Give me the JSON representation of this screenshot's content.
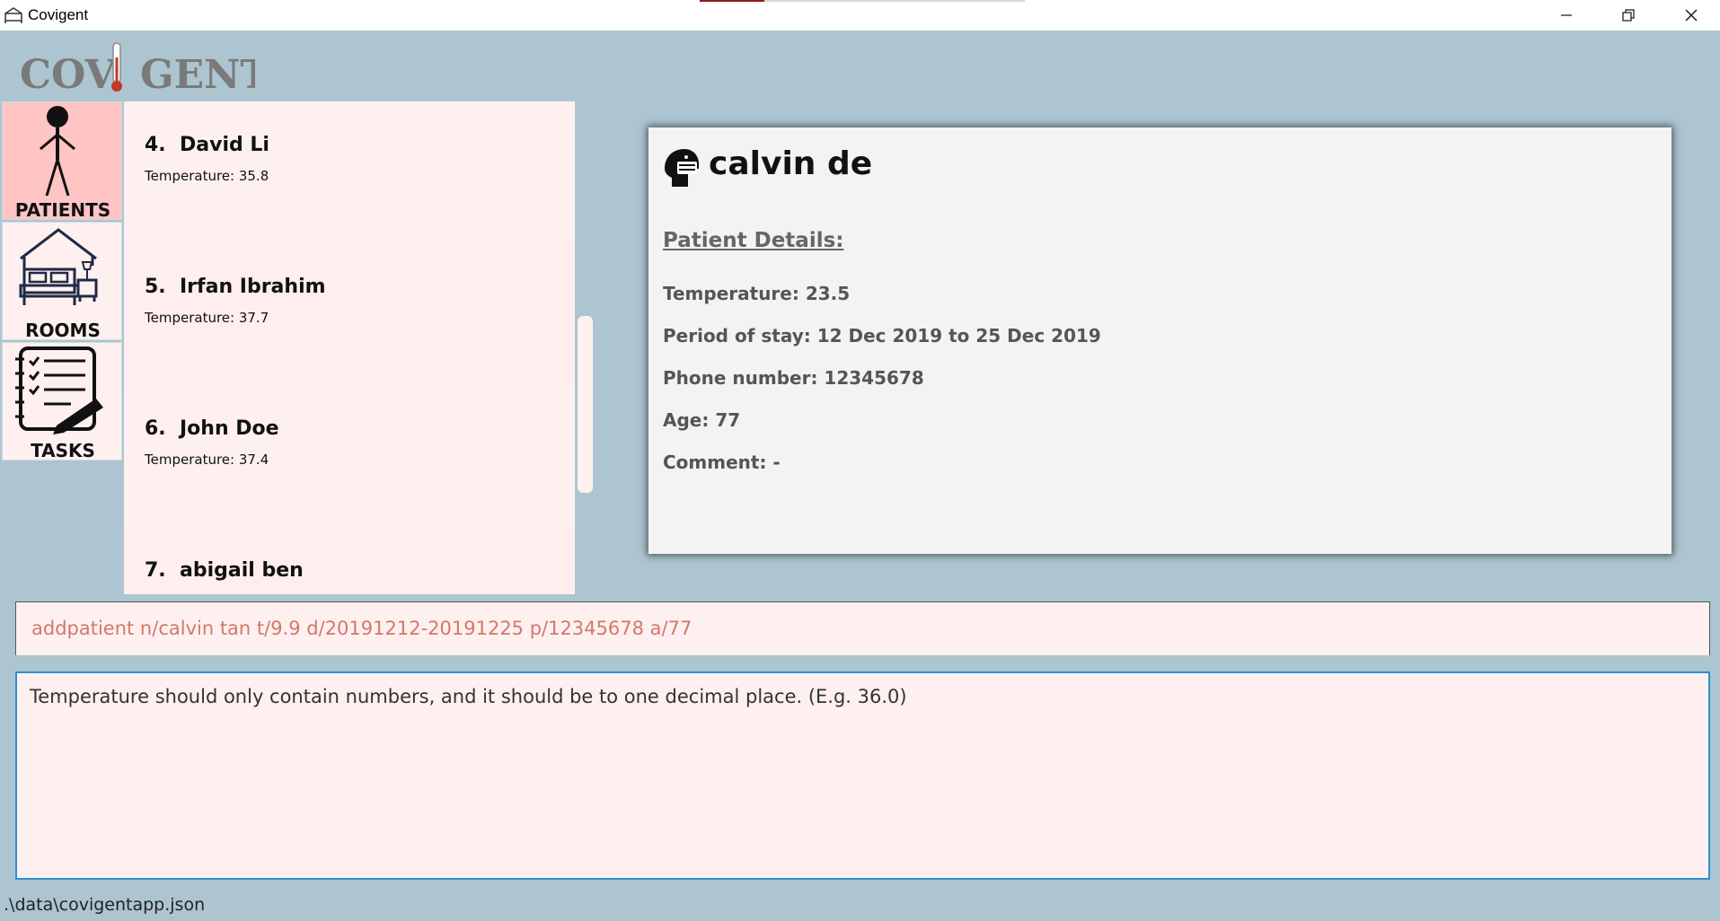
{
  "window": {
    "title": "Covigent"
  },
  "logo": {
    "text": "COVIGENT"
  },
  "nav": [
    {
      "label": "PATIENTS",
      "icon": "person-icon",
      "active": true
    },
    {
      "label": "ROOMS",
      "icon": "bed-room-icon",
      "active": false
    },
    {
      "label": "TASKS",
      "icon": "checklist-icon",
      "active": false
    }
  ],
  "patients": [
    {
      "index": "4.",
      "name": "David Li",
      "temperature": "Temperature: 35.8"
    },
    {
      "index": "5.",
      "name": "Irfan Ibrahim",
      "temperature": "Temperature: 37.7"
    },
    {
      "index": "6.",
      "name": "John Doe",
      "temperature": "Temperature: 37.4"
    },
    {
      "index": "7.",
      "name": "abigail ben",
      "temperature": ""
    }
  ],
  "detail": {
    "name": "calvin de",
    "heading": "Patient Details:",
    "temperature": "Temperature: 23.5",
    "period": "Period of stay: 12 Dec 2019 to 25 Dec 2019",
    "phone": "Phone number: 12345678",
    "age": "Age: 77",
    "comment": "Comment: -"
  },
  "command": {
    "value": "addpatient n/calvin tan t/9.9 d/20191212-20191225 p/12345678 a/77"
  },
  "result": {
    "text": "Temperature should only contain numbers, and it should be to one decimal place. (E.g. 36.0)"
  },
  "status": {
    "path": ".\\data\\covigentapp.json"
  },
  "colors": {
    "background": "#acc5d0",
    "panel": "#fff0f0",
    "active_nav": "#ffc4c4",
    "command_text": "#d2786a",
    "result_border": "#2f8fd0",
    "thermometer_red": "#c0392b"
  }
}
